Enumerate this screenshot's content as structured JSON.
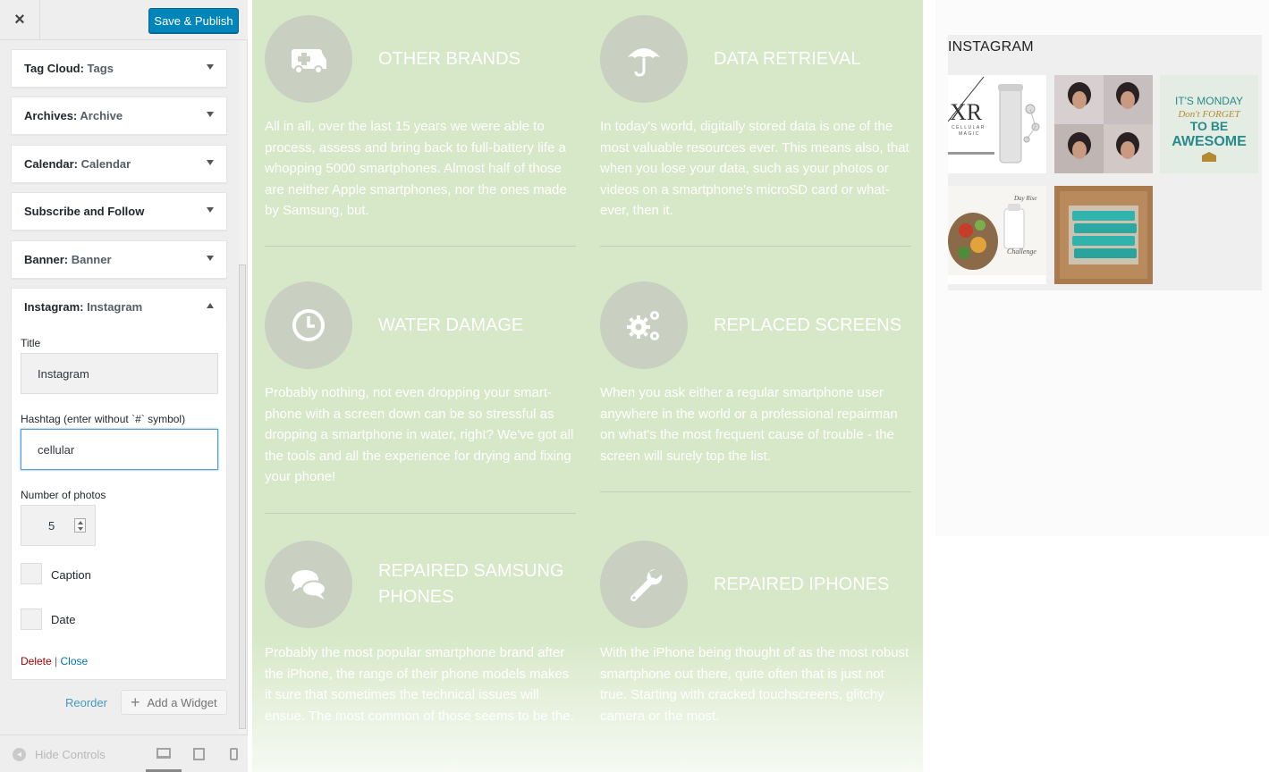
{
  "header": {
    "close_label": "×",
    "publish_label": "Save & Publish"
  },
  "widgets": [
    {
      "name": "Tag Cloud:",
      "sub": "Tags",
      "state": "collapsed"
    },
    {
      "name": "Archives:",
      "sub": "Archive",
      "state": "collapsed"
    },
    {
      "name": "Calendar:",
      "sub": "Calendar",
      "state": "collapsed"
    },
    {
      "name": "Subscribe and Follow",
      "sub": "",
      "state": "collapsed"
    },
    {
      "name": "Banner:",
      "sub": "Banner",
      "state": "collapsed"
    },
    {
      "name": "Instagram:",
      "sub": "Instagram",
      "state": "expanded"
    }
  ],
  "instagram_form": {
    "title_label": "Title",
    "title_value": "Instagram",
    "hashtag_label": "Hashtag (enter without `#` symbol)",
    "hashtag_value": "cellular",
    "photos_label": "Number of photos",
    "photos_value": "5",
    "caption_label": "Caption",
    "caption_checked": false,
    "date_label": "Date",
    "date_checked": false,
    "delete_label": "Delete",
    "separator": "|",
    "close_label": "Close"
  },
  "footer_actions": {
    "reorder_label": "Reorder",
    "add_widget_label": "Add a Widget"
  },
  "sidebar_footer": {
    "hide_controls_label": "Hide Controls",
    "devices": [
      "desktop",
      "tablet",
      "mobile"
    ],
    "active_device": "desktop"
  },
  "services": [
    {
      "icon": "ambulance-icon",
      "title": "OTHER BRANDS",
      "desc": "All in all, over the last 15 years we were able to process, assess and bring back to full-battery life a whopping 5000 smartphones. Almost half of those are neither Apple smartphones, nor the ones made by Samsung, but."
    },
    {
      "icon": "umbrella-icon",
      "title": "DATA RETRIEVAL",
      "desc": "In today's world, digitally stored data is one of the most valuable resources ever. This means also, that when you lose your data, such as your photos or videos on a smartphone's microSD card or what-ever, then it."
    },
    {
      "icon": "clock-icon",
      "title": "WATER DAMAGE",
      "desc": "Probably nothing, not even dropping your smart-phone with a screen down can be so stressful as dropping a smartphone in water, right? We've got all the tools and all the experience for drying and fixing your phone!"
    },
    {
      "icon": "gears-icon",
      "title": "REPLACED SCREENS",
      "desc": "When you ask either a regular smartphone user anywhere in the world or a professional repairman on what's the most frequent cause of trouble - the screen will surely top the list."
    },
    {
      "icon": "chat-icon",
      "title": "REPAIRED SAMSUNG PHONES",
      "desc": "Probably the most popular smartphone brand after the iPhone, the range of their phone models makes it sure that sometimes the technical issues will ensue. The most common of those seems to be the."
    },
    {
      "icon": "wrench-icon",
      "title": "REPAIRED IPHONES",
      "desc": "With the iPhone being thought of as the most robust smartphone out there, quite often that is just not true. Starting with cracked touchscreens, glitchy camera or the most."
    }
  ],
  "instagram": {
    "title": "INSTAGRAM",
    "photo1_logo": "XR",
    "photo1_line1": "CELLULAR",
    "photo1_line2": "MAGIC",
    "photo3_line1": "IT'S MONDAY",
    "photo3_line2": "Don't FORGET",
    "photo3_line3": "TO BE",
    "photo3_line4": "AWESOME",
    "photo4_label": "Day Rise",
    "photo4_sub": "Challenge"
  },
  "colors": {
    "publish": "#0085ba",
    "link": "#0073aa",
    "delete": "#a00000",
    "preview_bg": "#d6e8c7",
    "icon_circle": "#c9cfc1"
  }
}
